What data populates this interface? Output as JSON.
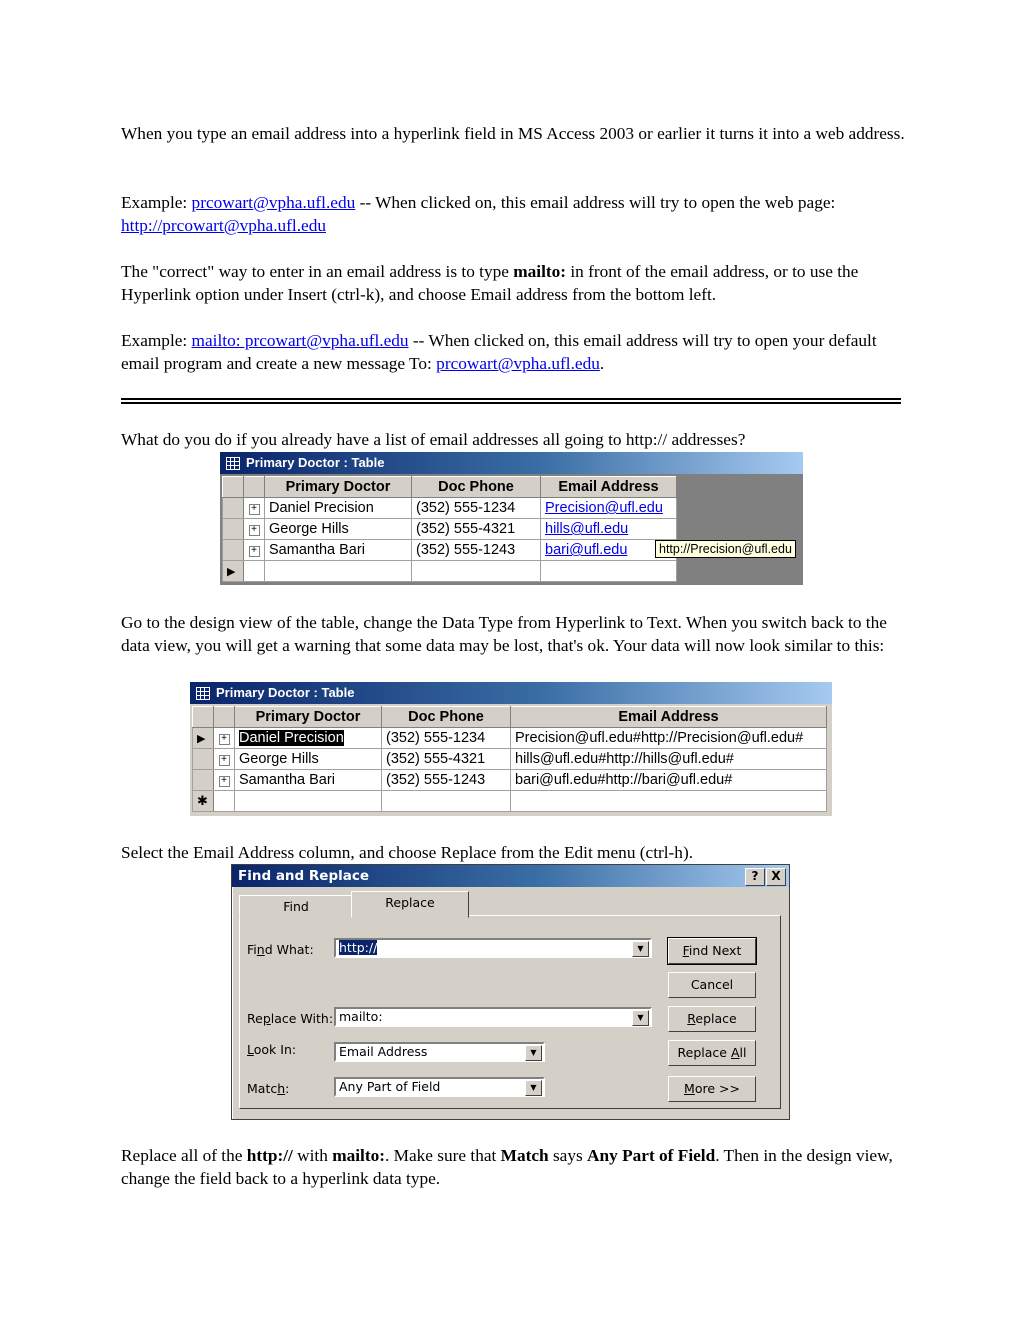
{
  "intro": {
    "para1": "When you type an email address into a hyperlink field in MS Access 2003 or earlier it turns it into a web address.",
    "example1_prefix": "Example: ",
    "example1_link": "prcowart@vpha.ufl.edu",
    "example1_mid": " -- When clicked on, this email address will try to open the web page:  ",
    "example1_link2": "http://prcowart@vpha.ufl.edu",
    "para3_a": "The \"correct\" way to enter in an email address is to type ",
    "para3_bold": "mailto:",
    "para3_b": " in front of the email address, or to use the Hyperlink option under Insert (ctrl-k), and choose Email address from the bottom left.",
    "example2_prefix": "Example: ",
    "example2_link": "mailto: prcowart@vpha.ufl.edu",
    "example2_mid": " -- When clicked on, this email address will try to open your default email program and create a new message To: ",
    "example2_link2": "prcowart@vpha.ufl.edu",
    "example2_end": "."
  },
  "question": "What do you do if you already have a list of email addresses all going to http:// addresses?",
  "table1": {
    "title": "Primary Doctor : Table",
    "columns": [
      "Primary Doctor",
      "Doc Phone",
      "Email Address"
    ],
    "rows": [
      {
        "doctor": "Daniel Precision",
        "phone": "(352) 555-1234",
        "email": "Precision@ufl.edu"
      },
      {
        "doctor": "George Hills",
        "phone": "(352) 555-4321",
        "email": "hills@ufl.edu"
      },
      {
        "doctor": "Samantha Bari",
        "phone": "(352) 555-1243",
        "email": "bari@ufl.edu"
      }
    ],
    "tooltip": "http://Precision@ufl.edu"
  },
  "step2": "Go to the design view of the table, change the Data Type from Hyperlink to Text.  When you switch back to the data view, you will get a warning that some data may be lost, that's ok.  Your data will now look similar to this:",
  "table2": {
    "title": "Primary Doctor : Table",
    "columns": [
      "Primary Doctor",
      "Doc Phone",
      "Email Address"
    ],
    "rows": [
      {
        "doctor": "Daniel Precision",
        "phone": "(352) 555-1234",
        "email": "Precision@ufl.edu#http://Precision@ufl.edu#"
      },
      {
        "doctor": "George Hills",
        "phone": "(352) 555-4321",
        "email": "hills@ufl.edu#http://hills@ufl.edu#"
      },
      {
        "doctor": "Samantha Bari",
        "phone": "(352) 555-1243",
        "email": "bari@ufl.edu#http://bari@ufl.edu#"
      }
    ]
  },
  "step3": "Select the Email Address column, and choose Replace from the Edit menu (ctrl-h).",
  "dialog": {
    "title": "Find and Replace",
    "help": "?",
    "close": "X",
    "tabs": [
      "Find",
      "Replace"
    ],
    "find_label_a": "Fi",
    "find_label_u": "n",
    "find_label_b": "d What:",
    "find_value": "http://",
    "replace_label_a": "Re",
    "replace_label_u": "p",
    "replace_label_b": "lace With:",
    "replace_value": "mailto:",
    "lookin_label_u": "L",
    "lookin_label_b": "ook In:",
    "lookin_value": "Email Address",
    "match_label_a": "Matc",
    "match_label_u": "h",
    "match_label_b": ":",
    "match_value": "Any Part of Field",
    "buttons": {
      "find_next_u": "F",
      "find_next": "ind Next",
      "cancel": "Cancel",
      "replace_u": "R",
      "replace": "eplace",
      "replace_all_a": "Replace ",
      "replace_all_u": "A",
      "replace_all_b": "ll",
      "more_u": "M",
      "more": "ore >>"
    }
  },
  "final": {
    "a": "Replace all of the ",
    "b1": "http://",
    "c": " with ",
    "b2": "mailto:",
    "d": ".  Make sure that ",
    "b3": "Match",
    "e": " says ",
    "b4": "Any Part of Field",
    "f": ".  Then in the design view, change the field back to a hyperlink data type."
  }
}
